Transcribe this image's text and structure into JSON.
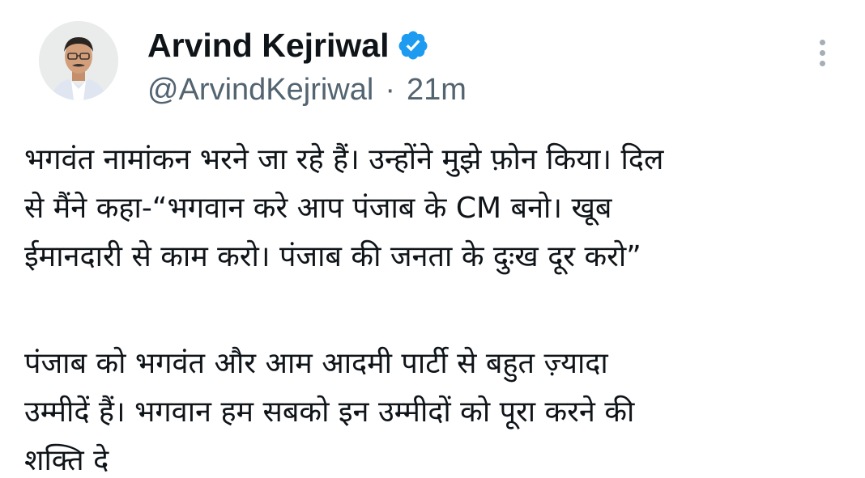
{
  "author": {
    "display_name": "Arvind Kejriwal",
    "handle": "@ArvindKejriwal",
    "separator": "·",
    "time": "21m",
    "verified": true,
    "verified_color": "#1d9bf0"
  },
  "icons": {
    "avatar": "profile-photo",
    "verified": "verified-badge-icon",
    "more": "more-options-icon"
  },
  "tweet": {
    "lines_para1": [
      "भगवंत नामांकन भरने जा रहे हैं। उन्होंने मुझे फ़ोन किया। दिल",
      "से मैंने कहा-“भगवान करे आप पंजाब के CM बनो। खूब",
      "ईमानदारी से काम करो। पंजाब की जनता के दुःख दूर करो”"
    ],
    "lines_para2": [
      "पंजाब को भगवंत और आम आदमी पार्टी से बहुत ज़्यादा",
      "उम्मीदें हैं। भगवान हम सबको इन उम्मीदों को पूरा करने की",
      "शक्ति दे"
    ]
  }
}
